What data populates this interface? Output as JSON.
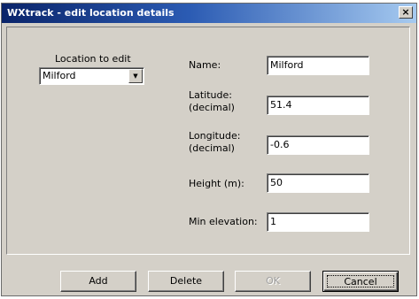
{
  "window": {
    "title": "WXtrack - edit location details",
    "close_label": "×"
  },
  "location_picker": {
    "label": "Location to edit",
    "selected": "Milford"
  },
  "fields": {
    "name": {
      "label": "Name:",
      "value": "Milford"
    },
    "latitude": {
      "label_line1": "Latitude:",
      "label_line2": "(decimal)",
      "value": "51.4"
    },
    "longitude": {
      "label_line1": "Longitude:",
      "label_line2": "(decimal)",
      "value": "-0.6"
    },
    "height": {
      "label": "Height (m):",
      "value": "50"
    },
    "min_elevation": {
      "label": "Min elevation:",
      "value": "1"
    }
  },
  "buttons": {
    "add": "Add",
    "delete": "Delete",
    "ok": "OK",
    "cancel": "Cancel"
  }
}
